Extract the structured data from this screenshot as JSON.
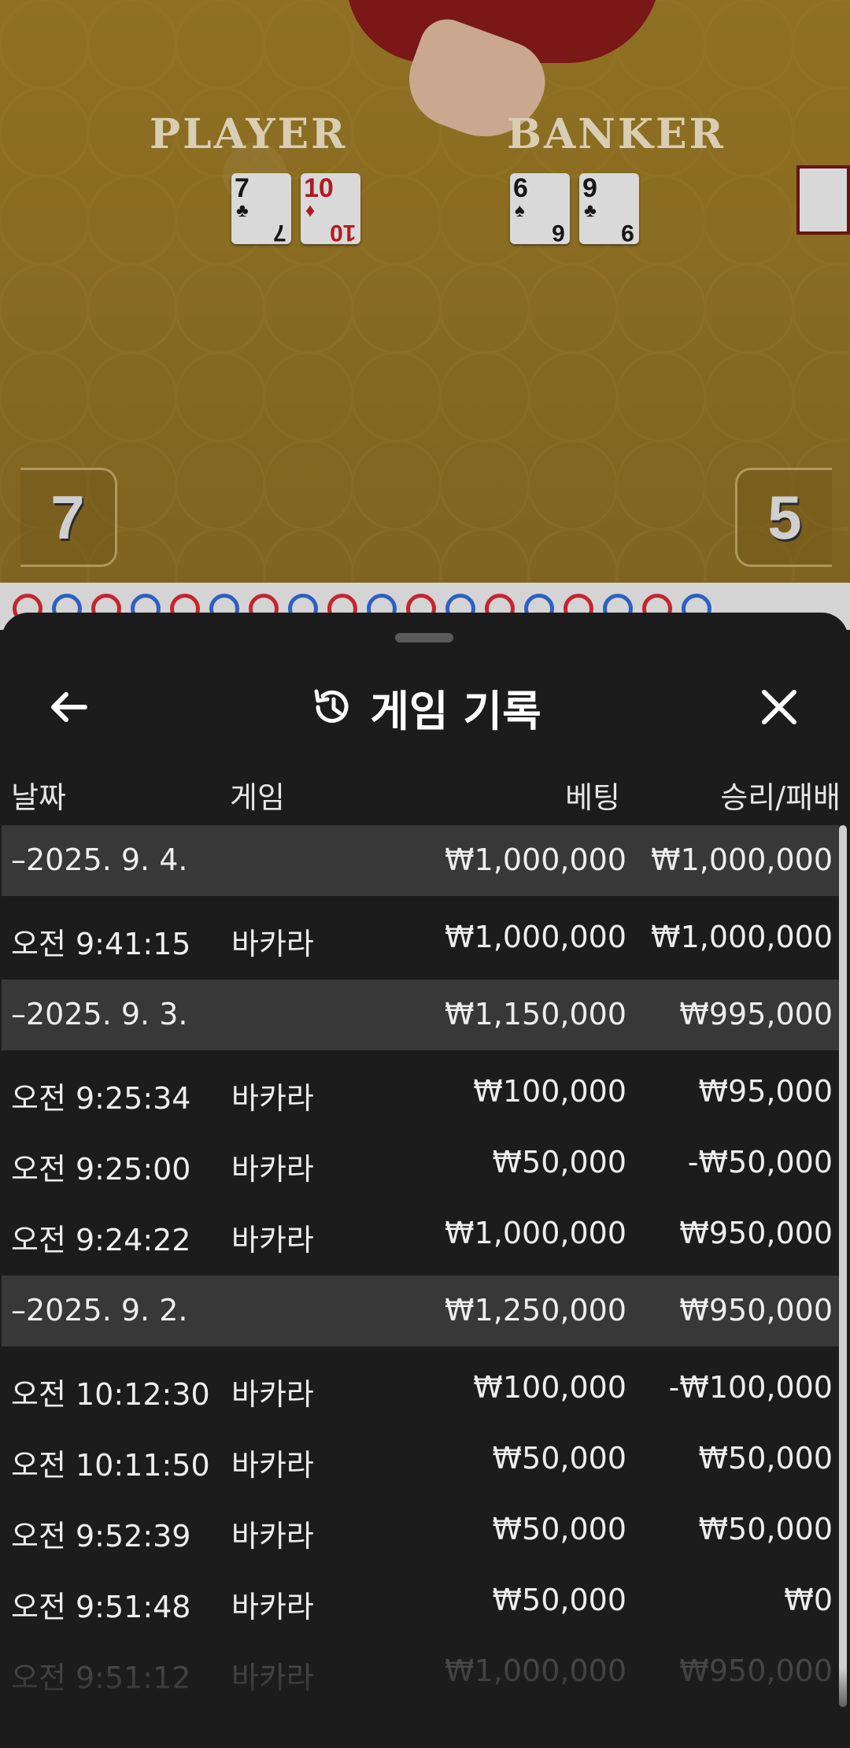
{
  "table": {
    "player_label": "PLAYER",
    "banker_label": "BANKER",
    "player_score": "7",
    "banker_score": "5",
    "player_cards": [
      {
        "rank": "7",
        "suit": "♣",
        "color": "black"
      },
      {
        "rank": "10",
        "suit": "♦",
        "color": "red"
      }
    ],
    "banker_cards": [
      {
        "rank": "6",
        "suit": "♠",
        "color": "black"
      },
      {
        "rank": "9",
        "suit": "♣",
        "color": "black"
      }
    ]
  },
  "sheet": {
    "title": "게임 기록",
    "back_icon": "arrow-left-icon",
    "history_icon": "history-icon",
    "close_icon": "close-icon"
  },
  "columns": {
    "date": "날짜",
    "game": "게임",
    "bet": "베팅",
    "win_loss": "승리/패배"
  },
  "rows": [
    {
      "type": "date",
      "time": "–2025. 9. 4.",
      "game": "",
      "bet": "₩1,000,000",
      "win": "₩1,000,000"
    },
    {
      "type": "entry",
      "time": "오전 9:41:15",
      "game": "바카라",
      "bet": "₩1,000,000",
      "win": "₩1,000,000"
    },
    {
      "type": "date",
      "time": "–2025. 9. 3.",
      "game": "",
      "bet": "₩1,150,000",
      "win": "₩995,000"
    },
    {
      "type": "entry",
      "time": "오전 9:25:34",
      "game": "바카라",
      "bet": "₩100,000",
      "win": "₩95,000"
    },
    {
      "type": "entry",
      "time": "오전 9:25:00",
      "game": "바카라",
      "bet": "₩50,000",
      "win": "-₩50,000"
    },
    {
      "type": "entry",
      "time": "오전 9:24:22",
      "game": "바카라",
      "bet": "₩1,000,000",
      "win": "₩950,000"
    },
    {
      "type": "date",
      "time": "–2025. 9. 2.",
      "game": "",
      "bet": "₩1,250,000",
      "win": "₩950,000"
    },
    {
      "type": "entry",
      "time": "오전 10:12:30",
      "game": "바카라",
      "bet": "₩100,000",
      "win": "-₩100,000"
    },
    {
      "type": "entry",
      "time": "오전 10:11:50",
      "game": "바카라",
      "bet": "₩50,000",
      "win": "₩50,000"
    },
    {
      "type": "entry",
      "time": "오전 9:52:39",
      "game": "바카라",
      "bet": "₩50,000",
      "win": "₩50,000"
    },
    {
      "type": "entry",
      "time": "오전 9:51:48",
      "game": "바카라",
      "bet": "₩50,000",
      "win": "₩0"
    },
    {
      "type": "entry",
      "time": "오전 9:51:12",
      "game": "바카라",
      "bet": "₩1,000,000",
      "win": "₩950,000"
    }
  ],
  "road": [
    "r",
    "b",
    "r",
    "b",
    "r",
    "b",
    "r",
    "b",
    "r",
    "b",
    "r",
    "b",
    "r",
    "b",
    "r",
    "b",
    "r",
    "b"
  ],
  "colors": {
    "sheet_bg": "#1c1c1c",
    "date_row_bg": "#383838",
    "banker_red": "#c52530",
    "player_blue": "#2d5fc4"
  }
}
